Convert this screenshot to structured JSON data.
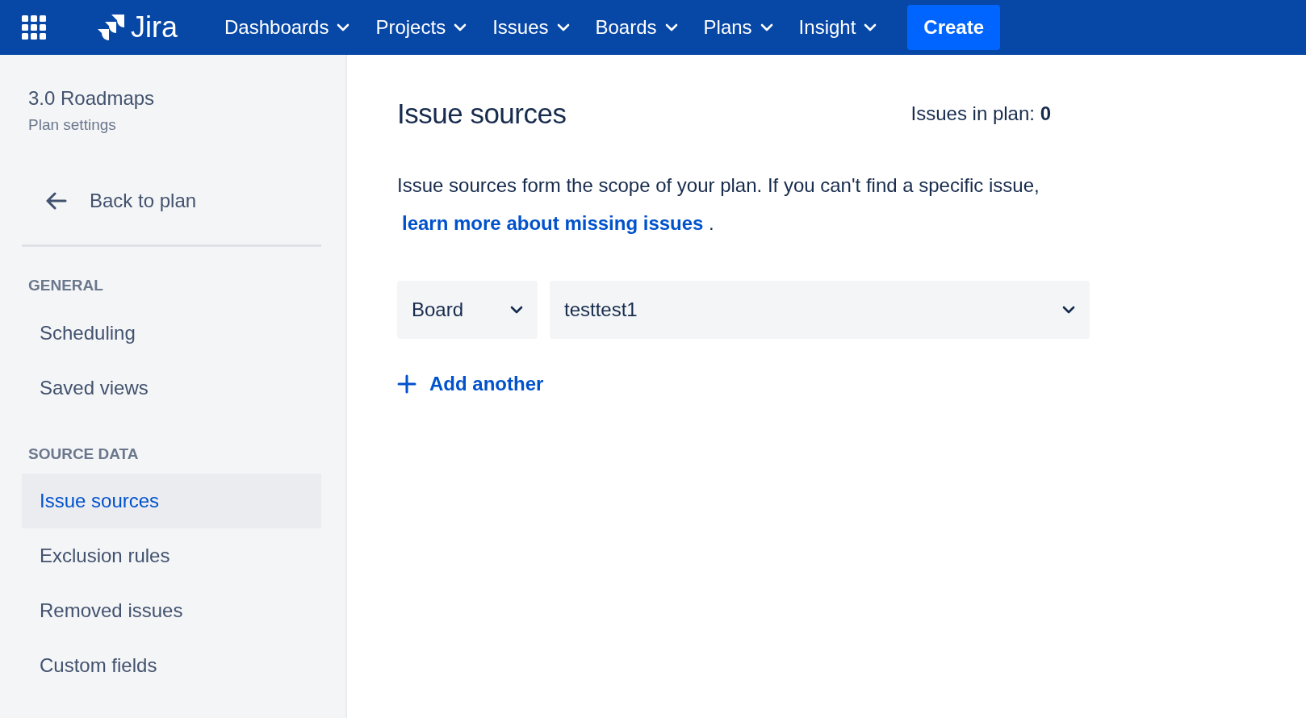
{
  "navbar": {
    "logo_text": "Jira",
    "menus": [
      {
        "label": "Dashboards"
      },
      {
        "label": "Projects"
      },
      {
        "label": "Issues"
      },
      {
        "label": "Boards"
      },
      {
        "label": "Plans"
      },
      {
        "label": "Insight"
      }
    ],
    "create_button": "Create"
  },
  "sidebar": {
    "title": "3.0 Roadmaps",
    "subtitle": "Plan settings",
    "back_link": "Back to plan",
    "sections": [
      {
        "heading": "GENERAL",
        "items": [
          {
            "label": "Scheduling",
            "selected": false
          },
          {
            "label": "Saved views",
            "selected": false
          }
        ]
      },
      {
        "heading": "SOURCE DATA",
        "items": [
          {
            "label": "Issue sources",
            "selected": true
          },
          {
            "label": "Exclusion rules",
            "selected": false
          },
          {
            "label": "Removed issues",
            "selected": false
          },
          {
            "label": "Custom fields",
            "selected": false
          }
        ]
      }
    ]
  },
  "main": {
    "title": "Issue sources",
    "count_label": "Issues in plan:",
    "count": "0",
    "description": "Issue sources form the scope of your plan. If you can't find a specific issue,",
    "link": "learn more about missing issues",
    "after_link": ".",
    "sources": [
      {
        "type": "Board",
        "value": "testtest1"
      }
    ],
    "add_button": "Add another"
  }
}
